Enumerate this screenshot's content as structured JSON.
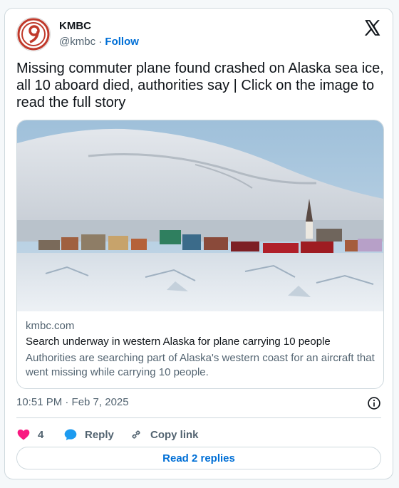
{
  "author": {
    "name": "KMBC",
    "handle": "@kmbc",
    "separator": "·",
    "follow_label": "Follow"
  },
  "tweet": {
    "text": "Missing commuter plane found crashed on Alaska sea ice, all 10 aboard died, authorities say | Click on the image to read the full story"
  },
  "link_card": {
    "domain": "kmbc.com",
    "title": "Search underway in western Alaska for plane carrying 10 people",
    "description": "Authorities are searching part of Alaska's western coast for an aircraft that went missing while carrying 10 people."
  },
  "timestamp": "10:51 PM · Feb 7, 2025",
  "actions": {
    "like_count": "4",
    "reply_label": "Reply",
    "copy_label": "Copy link"
  },
  "replies_button": "Read 2 replies",
  "colors": {
    "accent": "#006fd6",
    "like": "#f91880",
    "reply": "#1d9bf0",
    "logo_red": "#c0392b"
  },
  "icons": [
    "kmbc-logo-icon",
    "x-logo-icon",
    "info-icon",
    "heart-icon",
    "reply-bubble-icon",
    "link-icon"
  ]
}
